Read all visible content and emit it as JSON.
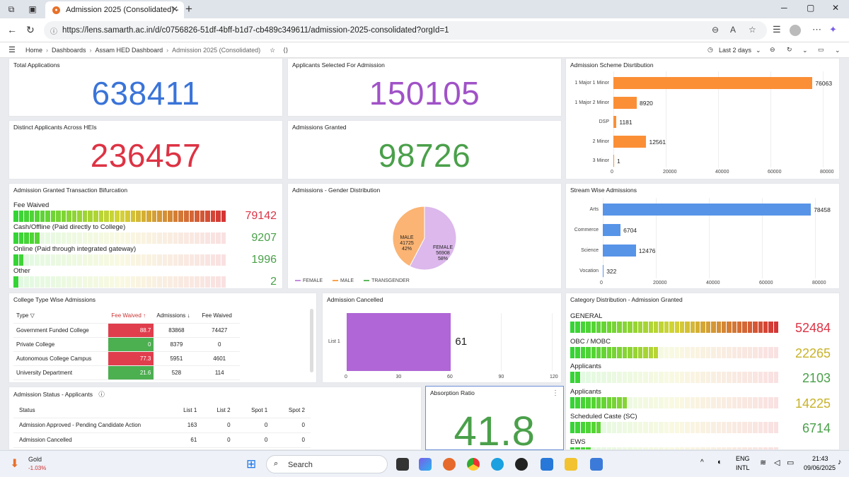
{
  "browser": {
    "tab_title": "Admission 2025 (Consolidated) -",
    "url": "https://lens.samarth.ac.in/d/c0756826-51df-4bff-b1d7-cb489c349611/admission-2025-consolidated?orgId=1"
  },
  "breadcrumb": [
    "Home",
    "Dashboards",
    "Assam HED Dashboard",
    "Admission 2025 (Consolidated)"
  ],
  "time_range": "Last 2 days",
  "stats": {
    "total_applications": {
      "title": "Total Applications",
      "value": "638411",
      "color": "#3a74d8"
    },
    "selected": {
      "title": "Applicants Selected For Admission",
      "value": "150105",
      "color": "#a052c7"
    },
    "distinct": {
      "title": "Distinct Applicants Across HEIs",
      "value": "236457",
      "color": "#dd3344"
    },
    "granted": {
      "title": "Admissions Granted",
      "value": "98726",
      "color": "#4aa04a"
    }
  },
  "scheme": {
    "title": "Admission Scheme Distribution",
    "display_title": "Admission Scheme Disrtibution",
    "categories": [
      "1 Major 1 Minor",
      "1 Major 2 Minor",
      "DSP",
      "2 Minor",
      "3 Minor"
    ],
    "values": [
      76063,
      8920,
      1181,
      12561,
      1
    ],
    "ticks": [
      "0",
      "20000",
      "40000",
      "60000",
      "80000"
    ],
    "color": "#fb8f36"
  },
  "transaction": {
    "title": "Admission Granted Transaction Bifurcation",
    "rows": [
      {
        "label": "Fee Waived",
        "value": "79142",
        "level": 1.0,
        "color": "#dd3344"
      },
      {
        "label": "Cash/Offline (Paid directly to College)",
        "value": "9207",
        "level": 0.12,
        "color": "#4aa04a"
      },
      {
        "label": "Online (Paid through integrated gateway)",
        "value": "1996",
        "level": 0.03,
        "color": "#4aa04a"
      },
      {
        "label": "Other",
        "value": "2",
        "level": 0.0,
        "color": "#4aa04a"
      }
    ]
  },
  "gender": {
    "title": "Admissions - Gender Distribution",
    "male_label": "MALE",
    "male_value": "41725",
    "male_pct": "42%",
    "female_label": "FEMALE",
    "female_value": "56908",
    "female_pct": "58%",
    "legend": [
      "FEMALE",
      "MALE",
      "TRANSGENDER"
    ]
  },
  "stream": {
    "title": "Stream Wise Admissions",
    "categories": [
      "Arts",
      "Commerce",
      "Science",
      "Vocation"
    ],
    "values": [
      78458,
      6704,
      12476,
      322
    ],
    "ticks": [
      "0",
      "20000",
      "40000",
      "60000",
      "80000"
    ],
    "color": "#5794e8"
  },
  "college": {
    "title": "College Type Wise Admissions",
    "headers": [
      "Type",
      "Fee Waived %",
      "Admissions",
      "Fee Waived"
    ],
    "display_headers": [
      "Type",
      "Fee Waived",
      "Admissions",
      "Fee Waived"
    ],
    "rows": [
      {
        "type": "Government Funded College",
        "pct": "88.7",
        "adm": "83868",
        "fw": "74427",
        "c": "red"
      },
      {
        "type": "Private College",
        "pct": "0",
        "adm": "8379",
        "fw": "0",
        "c": "green"
      },
      {
        "type": "Autonomous College Campus",
        "pct": "77.3",
        "adm": "5951",
        "fw": "4601",
        "c": "red"
      },
      {
        "type": "University Department",
        "pct": "21.6",
        "adm": "528",
        "fw": "114",
        "c": "green"
      }
    ]
  },
  "cancelled": {
    "title": "Admission Cancelled",
    "label": "List 1",
    "value": "61",
    "ticks": [
      "0",
      "30",
      "60",
      "90",
      "120"
    ]
  },
  "category": {
    "title": "Category Distribution - Admission Granted",
    "rows": [
      {
        "label": "GENERAL",
        "value": "52484",
        "level": 1.0,
        "color": "#dd3344"
      },
      {
        "label": "OBC / MOBC",
        "value": "22265",
        "level": 0.43,
        "color": "#c8b228"
      },
      {
        "label": "Applicants",
        "value": "2103",
        "level": 0.05,
        "color": "#4aa04a"
      },
      {
        "label": "Applicants",
        "value": "14225",
        "level": 0.28,
        "color": "#c8b228"
      },
      {
        "label": "Scheduled Caste (SC)",
        "value": "6714",
        "level": 0.13,
        "color": "#4aa04a"
      },
      {
        "label": "EWS",
        "value": "",
        "level": 0.1,
        "color": "#4aa04a"
      }
    ]
  },
  "status": {
    "title": "Admission Status - Applicants",
    "headers": [
      "Status",
      "List 1",
      "List 2",
      "Spot 1",
      "Spot 2"
    ],
    "rows": [
      [
        "Admission Approved - Pending Candidate Action",
        "163",
        "0",
        "0",
        "0"
      ],
      [
        "Admission Cancelled",
        "61",
        "0",
        "0",
        "0"
      ]
    ]
  },
  "absorption": {
    "title": "Absorption Ratio",
    "value": "41.8"
  },
  "taskbar": {
    "ticker_name": "Gold",
    "ticker_change": "-1.03%",
    "search": "Search",
    "lang1": "ENG",
    "lang2": "INTL",
    "time": "21:43",
    "date": "09/06/2025"
  }
}
